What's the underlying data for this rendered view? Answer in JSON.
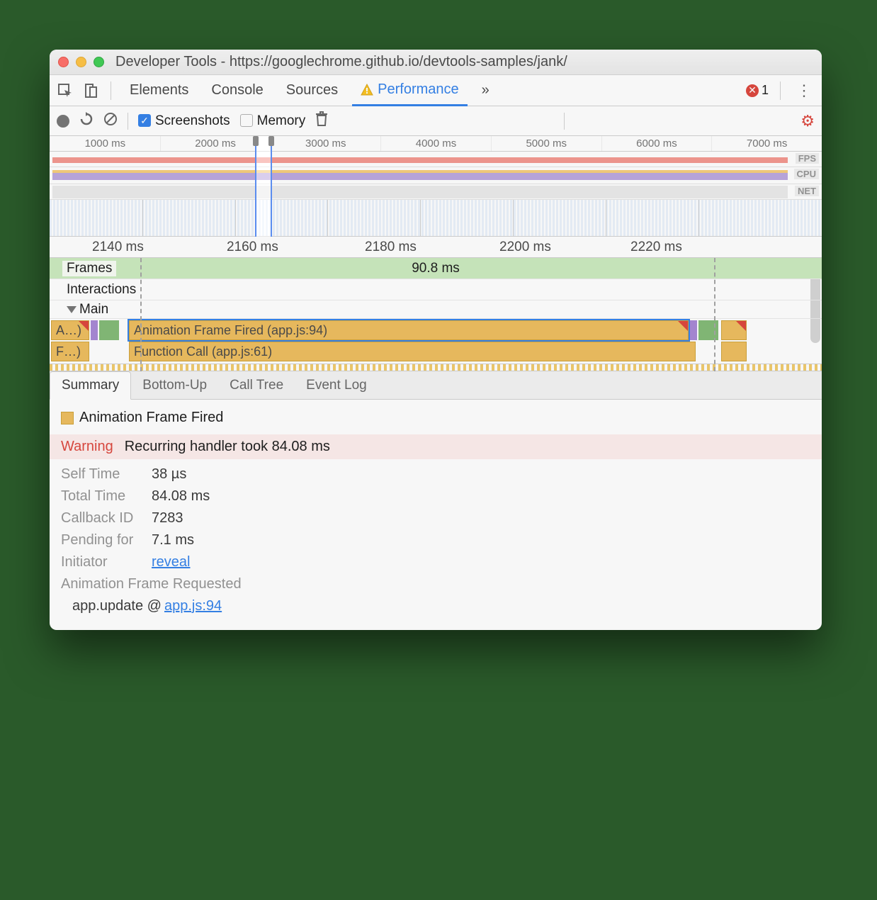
{
  "window_title": "Developer Tools - https://googlechrome.github.io/devtools-samples/jank/",
  "tabs": [
    "Elements",
    "Console",
    "Sources",
    "Performance"
  ],
  "tabs_more": "»",
  "error_count": "1",
  "toolbar": {
    "screenshots_label": "Screenshots",
    "memory_label": "Memory"
  },
  "overview_ticks": [
    "1000 ms",
    "2000 ms",
    "3000 ms",
    "4000 ms",
    "5000 ms",
    "6000 ms",
    "7000 ms"
  ],
  "overview_rows": {
    "fps": "FPS",
    "cpu": "CPU",
    "net": "NET"
  },
  "detail_ticks": [
    "2140 ms",
    "2160 ms",
    "2180 ms",
    "2200 ms",
    "2220 ms"
  ],
  "tracks": {
    "frames": "Frames",
    "frames_value": "90.8 ms",
    "interactions": "Interactions",
    "main": "Main"
  },
  "flame": {
    "trunc1": "A…)",
    "trunc2": "F…)",
    "bar1": "Animation Frame Fired (app.js:94)",
    "bar2": "Function Call (app.js:61)"
  },
  "detail_tabs": [
    "Summary",
    "Bottom-Up",
    "Call Tree",
    "Event Log"
  ],
  "summary": {
    "title": "Animation Frame Fired",
    "warning_label": "Warning",
    "warning_text": "Recurring handler took 84.08 ms",
    "self_time_k": "Self Time",
    "self_time_v": "38 µs",
    "total_time_k": "Total Time",
    "total_time_v": "84.08 ms",
    "callback_k": "Callback ID",
    "callback_v": "7283",
    "pending_k": "Pending for",
    "pending_v": "7.1 ms",
    "initiator_k": "Initiator",
    "initiator_v": "reveal",
    "sub": "Animation Frame Requested",
    "stack_pre": "app.update @ ",
    "stack_link": "app.js:94"
  }
}
